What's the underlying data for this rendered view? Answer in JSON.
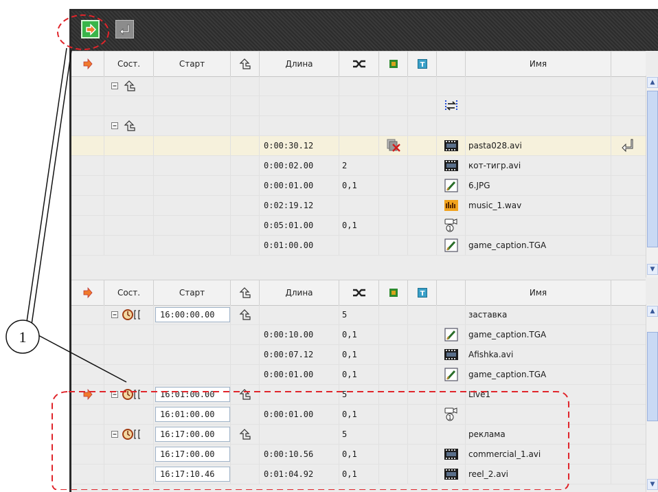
{
  "toolbar": {
    "buttons": [
      {
        "name": "play-from-cursor-button",
        "icon": "play-arrow-icon"
      },
      {
        "name": "insert-button",
        "icon": "enter-arrow-icon"
      }
    ]
  },
  "columns": {
    "state": "Сост.",
    "start": "Старт",
    "length": "Длина",
    "name": "Имя"
  },
  "top_rows": [
    {
      "type": "group",
      "trans": "",
      "length": "",
      "icon": "",
      "name": ""
    },
    {
      "type": "marker",
      "trans": "",
      "length": "",
      "icon": "transition-marker-icon",
      "name": ""
    },
    {
      "type": "group",
      "trans": "",
      "length": "",
      "icon": "",
      "name": ""
    },
    {
      "type": "clip",
      "highlight": true,
      "length": "0:00:30.12",
      "trans": "",
      "icon": "film-icon",
      "name": "pasta028.avi",
      "extra": "disabled-cross-icon"
    },
    {
      "type": "clip",
      "length": "0:00:02.00",
      "trans": "2",
      "icon": "film-icon",
      "name": "кот-тигр.avi"
    },
    {
      "type": "clip",
      "length": "0:00:01.00",
      "trans": "0,1",
      "icon": "image-icon",
      "name": "6.JPG"
    },
    {
      "type": "clip",
      "length": "0:02:19.12",
      "trans": "",
      "icon": "audio-icon",
      "name": "music_1.wav"
    },
    {
      "type": "clip",
      "length": "0:05:01.00",
      "trans": "0,1",
      "icon": "live-camera-icon",
      "name": ""
    },
    {
      "type": "clip",
      "length": "0:01:00.00",
      "trans": "",
      "icon": "image-icon",
      "name": "game_caption.TGA"
    }
  ],
  "bottom_rows": [
    {
      "type": "group",
      "start": "16:00:00.00",
      "length": "",
      "trans": "5",
      "icon": "",
      "name": "заставка"
    },
    {
      "type": "clip",
      "start": "",
      "length": "0:00:10.00",
      "trans": "0,1",
      "icon": "image-icon",
      "name": "game_caption.TGA"
    },
    {
      "type": "clip",
      "start": "",
      "length": "0:00:07.12",
      "trans": "0,1",
      "icon": "film-icon",
      "name": "Afishka.avi"
    },
    {
      "type": "clip",
      "start": "",
      "length": "0:00:01.00",
      "trans": "0,1",
      "icon": "image-icon",
      "name": "game_caption.TGA"
    },
    {
      "type": "group",
      "cursor": true,
      "start": "16:01:00.00",
      "length": "",
      "trans": "5",
      "icon": "",
      "name": "Live1"
    },
    {
      "type": "clip",
      "start": "16:01:00.00",
      "length": "0:00:01.00",
      "trans": "0,1",
      "icon": "live-camera-icon",
      "name": ""
    },
    {
      "type": "group",
      "start": "16:17:00.00",
      "length": "",
      "trans": "5",
      "icon": "",
      "name": "реклама"
    },
    {
      "type": "clip",
      "start": "16:17:00.00",
      "length": "0:00:10.56",
      "trans": "0,1",
      "icon": "film-icon",
      "name": "commercial_1.avi"
    },
    {
      "type": "clip",
      "start": "16:17:10.46",
      "length": "0:01:04.92",
      "trans": "0,1",
      "icon": "film-icon",
      "name": "reel_2.avi"
    }
  ],
  "callout": {
    "label": "1"
  },
  "colors": {
    "accent_red": "#e0242a",
    "play_green": "#39b54a",
    "highlight_row": "#f6f1dc"
  }
}
